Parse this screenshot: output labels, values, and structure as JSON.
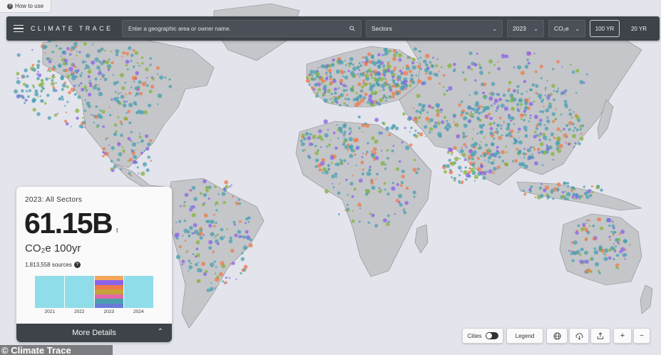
{
  "help": {
    "label": "How to use"
  },
  "topbar": {
    "logo": "CLIMATE TRACE",
    "search_placeholder": "Enter a geographic area or owner name.",
    "sector_value": "Sectors",
    "year_value": "2023",
    "gas_value": "CO₂e",
    "btn_100yr": "100 YR",
    "btn_20yr": "20 YR"
  },
  "panel": {
    "title": "2023: All Sectors",
    "value": "61.15B",
    "value_unit": "t",
    "unit": "CO₂e 100yr",
    "sources": "1,813,558 sources",
    "years": [
      "2021",
      "2022",
      "2023",
      "2024"
    ],
    "more_label": "More Details"
  },
  "controls": {
    "cities": "Cities",
    "legend": "Legend"
  },
  "icons": [
    "menu-icon",
    "search-icon",
    "chevron-down-icon",
    "question-icon",
    "chevron-up-icon",
    "globe-icon",
    "cloud-download-icon",
    "share-icon",
    "zoom-in-icon",
    "zoom-out-icon"
  ],
  "colors": {
    "ocean": "#e3e4ec",
    "land": "#c4c6c9",
    "topbar": "#3e4249",
    "teal": "#4a9fb0",
    "purple": "#8b62e8",
    "orange": "#ef7a4a",
    "green": "#86b33a",
    "bar_cyan": "#8fdde8"
  },
  "watermark": "© Climate Trace"
}
